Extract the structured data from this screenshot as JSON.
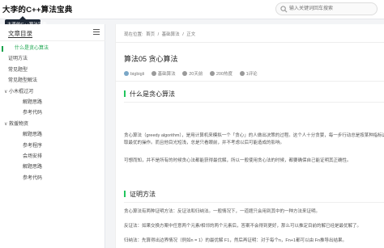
{
  "header": {
    "site_title": "大李的C++算法宝典",
    "search_placeholder": "输入关键词回车搜索"
  },
  "tooltip": {
    "text": "大李的C++算法宝典"
  },
  "sidebar": {
    "toc_title": "文章目录",
    "items": [
      {
        "label": "什么是贪心算法",
        "level": 2,
        "active": true,
        "toggle": ""
      },
      {
        "label": "证明方法",
        "level": 1,
        "active": false,
        "toggle": ""
      },
      {
        "label": "常见题型",
        "level": 1,
        "active": false,
        "toggle": ""
      },
      {
        "label": "常见题型解法",
        "level": 1,
        "active": false,
        "toggle": ""
      },
      {
        "label": "小木棍过河",
        "level": 1,
        "active": false,
        "toggle": "∨"
      },
      {
        "label": "解题思路",
        "level": 2,
        "active": false,
        "toggle": ""
      },
      {
        "label": "参考代码",
        "level": 2,
        "active": false,
        "toggle": ""
      },
      {
        "label": "救援物资",
        "level": 1,
        "active": false,
        "toggle": "∨"
      },
      {
        "label": "解题思路",
        "level": 2,
        "active": false,
        "toggle": ""
      },
      {
        "label": "参考程序",
        "level": 2,
        "active": false,
        "toggle": ""
      },
      {
        "label": "会场安排",
        "level": 2,
        "active": false,
        "toggle": ""
      },
      {
        "label": "解题思路",
        "level": 2,
        "active": false,
        "toggle": ""
      },
      {
        "label": "参考代码",
        "level": 2,
        "active": false,
        "toggle": ""
      }
    ]
  },
  "main": {
    "breadcrumb": [
      "现在位置:",
      "首页",
      "/",
      "基础算法",
      "/",
      "正文"
    ],
    "title": "算法05 贪心算法",
    "meta": {
      "author": "bigbigli",
      "category": "基础算法",
      "date": "20天前",
      "views": "200热度",
      "comments": "1评论"
    },
    "sections": [
      {
        "heading": "什么是贪心算法",
        "paragraphs": [
          "贪心算法（greedy algorithm），是用计算机来模拟一个「贪心」的人做出决策的过程。这个人十分贪婪，每一步行动总是按某种指标选",
          "取最优的操作。而且他目光短浅，总是只看眼前，并不考虑以后可能造成的影响。",
          "可想而知，并不是所有的时候贪心法都能获得最优解，所以一般使用贪心法的时候，都要确保自己能证明其正确性。"
        ]
      },
      {
        "heading": "证明方法",
        "paragraphs": [
          "贪心算法有两种证明方法：反证法和归纳法。一般情况下，一道题只会用到其中的一种方法来证明。",
          "反证法：如果交换方案中任意两个元素/相邻的两个元素后，答案不会得到更好，那么可以推定目前的解已经是最优解了。",
          "归纳法：先算得出边界情况（例如n = 1）的最优解 F1，然后再证明：对于每个n，Fn+1都可以由 Fn推导出结果。"
        ]
      }
    ]
  }
}
